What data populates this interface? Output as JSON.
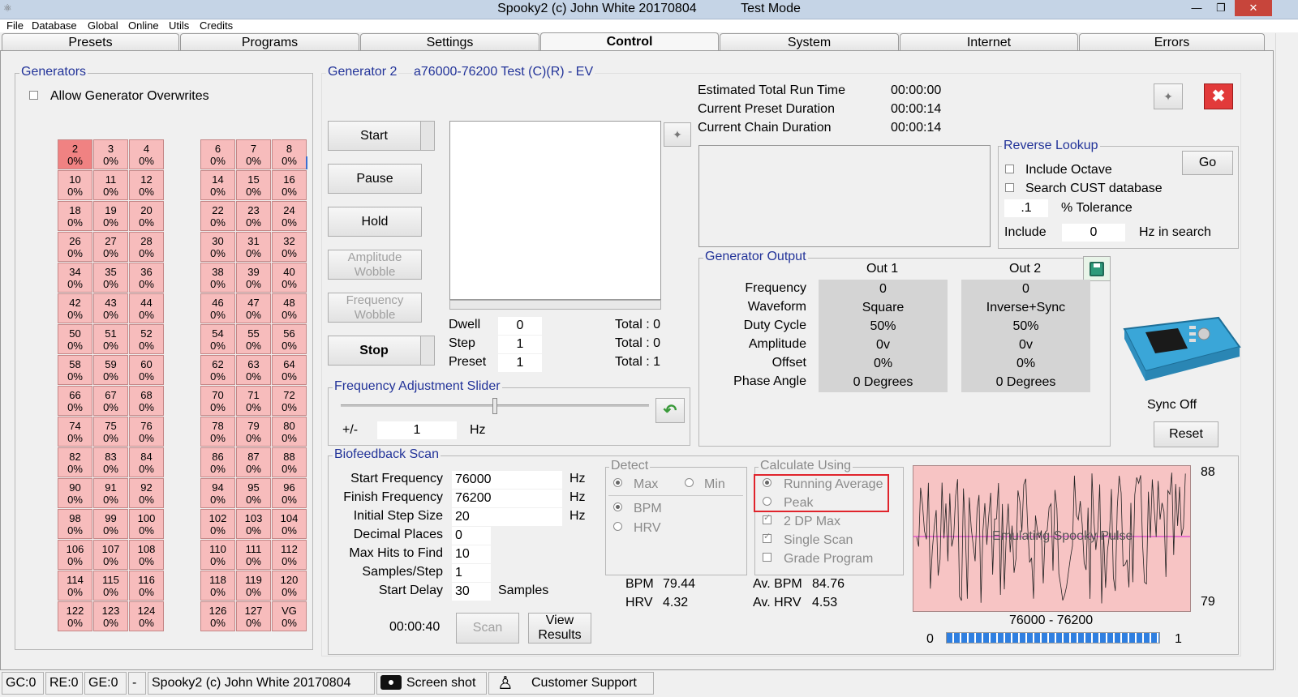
{
  "window": {
    "title": "Spooky2 (c) John White 20170804",
    "mode": "Test Mode",
    "minimize": "—",
    "restore": "❐",
    "close": "✕"
  },
  "menu": [
    "File",
    "Database",
    "Global",
    "Online",
    "Utils",
    "Credits"
  ],
  "tabs": [
    "Presets",
    "Programs",
    "Settings",
    "Control",
    "System",
    "Internet",
    "Errors"
  ],
  "active_tab": "Control",
  "generators": {
    "title": "Generators",
    "allow_overwrites": "Allow Generator Overwrites",
    "left_column": [
      [
        {
          "n": "2",
          "p": "0%"
        },
        {
          "n": "3",
          "p": "0%"
        },
        {
          "n": "4",
          "p": "0%"
        }
      ],
      [
        {
          "n": "10",
          "p": "0%"
        },
        {
          "n": "11",
          "p": "0%"
        },
        {
          "n": "12",
          "p": "0%"
        }
      ],
      [
        {
          "n": "18",
          "p": "0%"
        },
        {
          "n": "19",
          "p": "0%"
        },
        {
          "n": "20",
          "p": "0%"
        }
      ],
      [
        {
          "n": "26",
          "p": "0%"
        },
        {
          "n": "27",
          "p": "0%"
        },
        {
          "n": "28",
          "p": "0%"
        }
      ],
      [
        {
          "n": "34",
          "p": "0%"
        },
        {
          "n": "35",
          "p": "0%"
        },
        {
          "n": "36",
          "p": "0%"
        }
      ],
      [
        {
          "n": "42",
          "p": "0%"
        },
        {
          "n": "43",
          "p": "0%"
        },
        {
          "n": "44",
          "p": "0%"
        }
      ],
      [
        {
          "n": "50",
          "p": "0%"
        },
        {
          "n": "51",
          "p": "0%"
        },
        {
          "n": "52",
          "p": "0%"
        }
      ],
      [
        {
          "n": "58",
          "p": "0%"
        },
        {
          "n": "59",
          "p": "0%"
        },
        {
          "n": "60",
          "p": "0%"
        }
      ],
      [
        {
          "n": "66",
          "p": "0%"
        },
        {
          "n": "67",
          "p": "0%"
        },
        {
          "n": "68",
          "p": "0%"
        }
      ],
      [
        {
          "n": "74",
          "p": "0%"
        },
        {
          "n": "75",
          "p": "0%"
        },
        {
          "n": "76",
          "p": "0%"
        }
      ],
      [
        {
          "n": "82",
          "p": "0%"
        },
        {
          "n": "83",
          "p": "0%"
        },
        {
          "n": "84",
          "p": "0%"
        }
      ],
      [
        {
          "n": "90",
          "p": "0%"
        },
        {
          "n": "91",
          "p": "0%"
        },
        {
          "n": "92",
          "p": "0%"
        }
      ],
      [
        {
          "n": "98",
          "p": "0%"
        },
        {
          "n": "99",
          "p": "0%"
        },
        {
          "n": "100",
          "p": "0%"
        }
      ],
      [
        {
          "n": "106",
          "p": "0%"
        },
        {
          "n": "107",
          "p": "0%"
        },
        {
          "n": "108",
          "p": "0%"
        }
      ],
      [
        {
          "n": "114",
          "p": "0%"
        },
        {
          "n": "115",
          "p": "0%"
        },
        {
          "n": "116",
          "p": "0%"
        }
      ],
      [
        {
          "n": "122",
          "p": "0%"
        },
        {
          "n": "123",
          "p": "0%"
        },
        {
          "n": "124",
          "p": "0%"
        }
      ]
    ],
    "right_column": [
      [
        {
          "n": "6",
          "p": "0%"
        },
        {
          "n": "7",
          "p": "0%"
        },
        {
          "n": "8",
          "p": "0%"
        }
      ],
      [
        {
          "n": "14",
          "p": "0%"
        },
        {
          "n": "15",
          "p": "0%"
        },
        {
          "n": "16",
          "p": "0%"
        }
      ],
      [
        {
          "n": "22",
          "p": "0%"
        },
        {
          "n": "23",
          "p": "0%"
        },
        {
          "n": "24",
          "p": "0%"
        }
      ],
      [
        {
          "n": "30",
          "p": "0%"
        },
        {
          "n": "31",
          "p": "0%"
        },
        {
          "n": "32",
          "p": "0%"
        }
      ],
      [
        {
          "n": "38",
          "p": "0%"
        },
        {
          "n": "39",
          "p": "0%"
        },
        {
          "n": "40",
          "p": "0%"
        }
      ],
      [
        {
          "n": "46",
          "p": "0%"
        },
        {
          "n": "47",
          "p": "0%"
        },
        {
          "n": "48",
          "p": "0%"
        }
      ],
      [
        {
          "n": "54",
          "p": "0%"
        },
        {
          "n": "55",
          "p": "0%"
        },
        {
          "n": "56",
          "p": "0%"
        }
      ],
      [
        {
          "n": "62",
          "p": "0%"
        },
        {
          "n": "63",
          "p": "0%"
        },
        {
          "n": "64",
          "p": "0%"
        }
      ],
      [
        {
          "n": "70",
          "p": "0%"
        },
        {
          "n": "71",
          "p": "0%"
        },
        {
          "n": "72",
          "p": "0%"
        }
      ],
      [
        {
          "n": "78",
          "p": "0%"
        },
        {
          "n": "79",
          "p": "0%"
        },
        {
          "n": "80",
          "p": "0%"
        }
      ],
      [
        {
          "n": "86",
          "p": "0%"
        },
        {
          "n": "87",
          "p": "0%"
        },
        {
          "n": "88",
          "p": "0%"
        }
      ],
      [
        {
          "n": "94",
          "p": "0%"
        },
        {
          "n": "95",
          "p": "0%"
        },
        {
          "n": "96",
          "p": "0%"
        }
      ],
      [
        {
          "n": "102",
          "p": "0%"
        },
        {
          "n": "103",
          "p": "0%"
        },
        {
          "n": "104",
          "p": "0%"
        }
      ],
      [
        {
          "n": "110",
          "p": "0%"
        },
        {
          "n": "111",
          "p": "0%"
        },
        {
          "n": "112",
          "p": "0%"
        }
      ],
      [
        {
          "n": "118",
          "p": "0%"
        },
        {
          "n": "119",
          "p": "0%"
        },
        {
          "n": "120",
          "p": "0%"
        }
      ],
      [
        {
          "n": "126",
          "p": "0%"
        },
        {
          "n": "127",
          "p": "0%"
        },
        {
          "n": "VG",
          "p": "0%"
        }
      ]
    ],
    "selected": "2"
  },
  "generator_panel": {
    "title": "Generator 2",
    "program": "a76000-76200 Test (C)(R) - EV",
    "buttons": {
      "start": "Start",
      "pause": "Pause",
      "hold": "Hold",
      "amp_wobble": "Amplitude Wobble",
      "freq_wobble": "Frequency Wobble",
      "stop": "Stop"
    },
    "counters": [
      {
        "label": "Dwell",
        "value": "0",
        "total": "Total : 0"
      },
      {
        "label": "Step",
        "value": "1",
        "total": "Total : 0"
      },
      {
        "label": "Preset",
        "value": "1",
        "total": "Total : 1"
      }
    ],
    "run_times": [
      {
        "label": "Estimated Total Run Time",
        "value": "00:00:00"
      },
      {
        "label": "Current Preset Duration",
        "value": "00:00:14"
      },
      {
        "label": "Current Chain Duration",
        "value": "00:00:14"
      }
    ]
  },
  "reverse_lookup": {
    "title": "Reverse Lookup",
    "go": "Go",
    "include_octave": "Include Octave",
    "search_cust": "Search CUST database",
    "tolerance_value": ".1",
    "tolerance_label": "% Tolerance",
    "include_label": "Include",
    "include_value": "0",
    "hz_in_search": "Hz in search"
  },
  "generator_output": {
    "title": "Generator Output",
    "headers": [
      "Out 1",
      "Out 2"
    ],
    "rows": [
      {
        "label": "Frequency",
        "out1": "0",
        "out2": "0"
      },
      {
        "label": "Waveform",
        "out1": "Square",
        "out2": "Inverse+Sync"
      },
      {
        "label": "Duty Cycle",
        "out1": "50%",
        "out2": "50%"
      },
      {
        "label": "Amplitude",
        "out1": "0v",
        "out2": "0v"
      },
      {
        "label": "Offset",
        "out1": "0%",
        "out2": "0%"
      },
      {
        "label": "Phase Angle",
        "out1": "0 Degrees",
        "out2": "0 Degrees"
      }
    ],
    "sync": "Sync Off",
    "reset": "Reset"
  },
  "freq_slider": {
    "title": "Frequency Adjustment Slider",
    "pm": "+/-",
    "value": "1",
    "unit": "Hz",
    "position": 0.5
  },
  "biofeedback": {
    "title": "Biofeedback Scan",
    "fields": [
      {
        "label": "Start Frequency",
        "value": "76000",
        "unit": "Hz"
      },
      {
        "label": "Finish Frequency",
        "value": "76200",
        "unit": "Hz"
      },
      {
        "label": "Initial Step Size",
        "value": "20",
        "unit": "Hz"
      },
      {
        "label": "Decimal Places",
        "value": "0",
        "unit": ""
      },
      {
        "label": "Max Hits to Find",
        "value": "10",
        "unit": ""
      },
      {
        "label": "Samples/Step",
        "value": "1",
        "unit": ""
      },
      {
        "label": "Start Delay",
        "value": "30",
        "unit": "Samples"
      }
    ],
    "elapsed": "00:00:40",
    "scan": "Scan",
    "view_results": "View Results",
    "detect": {
      "title": "Detect",
      "max": "Max",
      "min": "Min",
      "bpm": "BPM",
      "hrv": "HRV"
    },
    "calc": {
      "title": "Calculate Using",
      "running_average": "Running Average",
      "peak": "Peak",
      "two_dp_max": "2 DP Max",
      "single_scan": "Single Scan",
      "grade_program": "Grade Program"
    },
    "stats": {
      "bpm_label": "BPM",
      "bpm": "79.44",
      "hrv_label": "HRV",
      "hrv": "4.32",
      "av_bpm_label": "Av. BPM",
      "av_bpm": "84.76",
      "av_hrv_label": "Av. HRV",
      "av_hrv": "4.53"
    },
    "graph": {
      "overlay": "Emulating Spooky Pulse",
      "y_max": "88",
      "y_min": "79",
      "range": "76000 - 76200",
      "bar_left": "0",
      "bar_right": "1",
      "progress": 1.0
    }
  },
  "statusbar": {
    "gc": "GC:0",
    "re": "RE:0",
    "ge": "GE:0",
    "dash": "-",
    "title": "Spooky2 (c) John White 20170804",
    "screenshot": "Screen shot",
    "support": "Customer Support"
  },
  "colors": {
    "cell": "#f7bcbc",
    "cell_selected": "#f08282",
    "group_title": "#223399",
    "graph_bg": "#f7c4c4",
    "highlight": "#e0242c",
    "progress": "#2f7fe0"
  }
}
